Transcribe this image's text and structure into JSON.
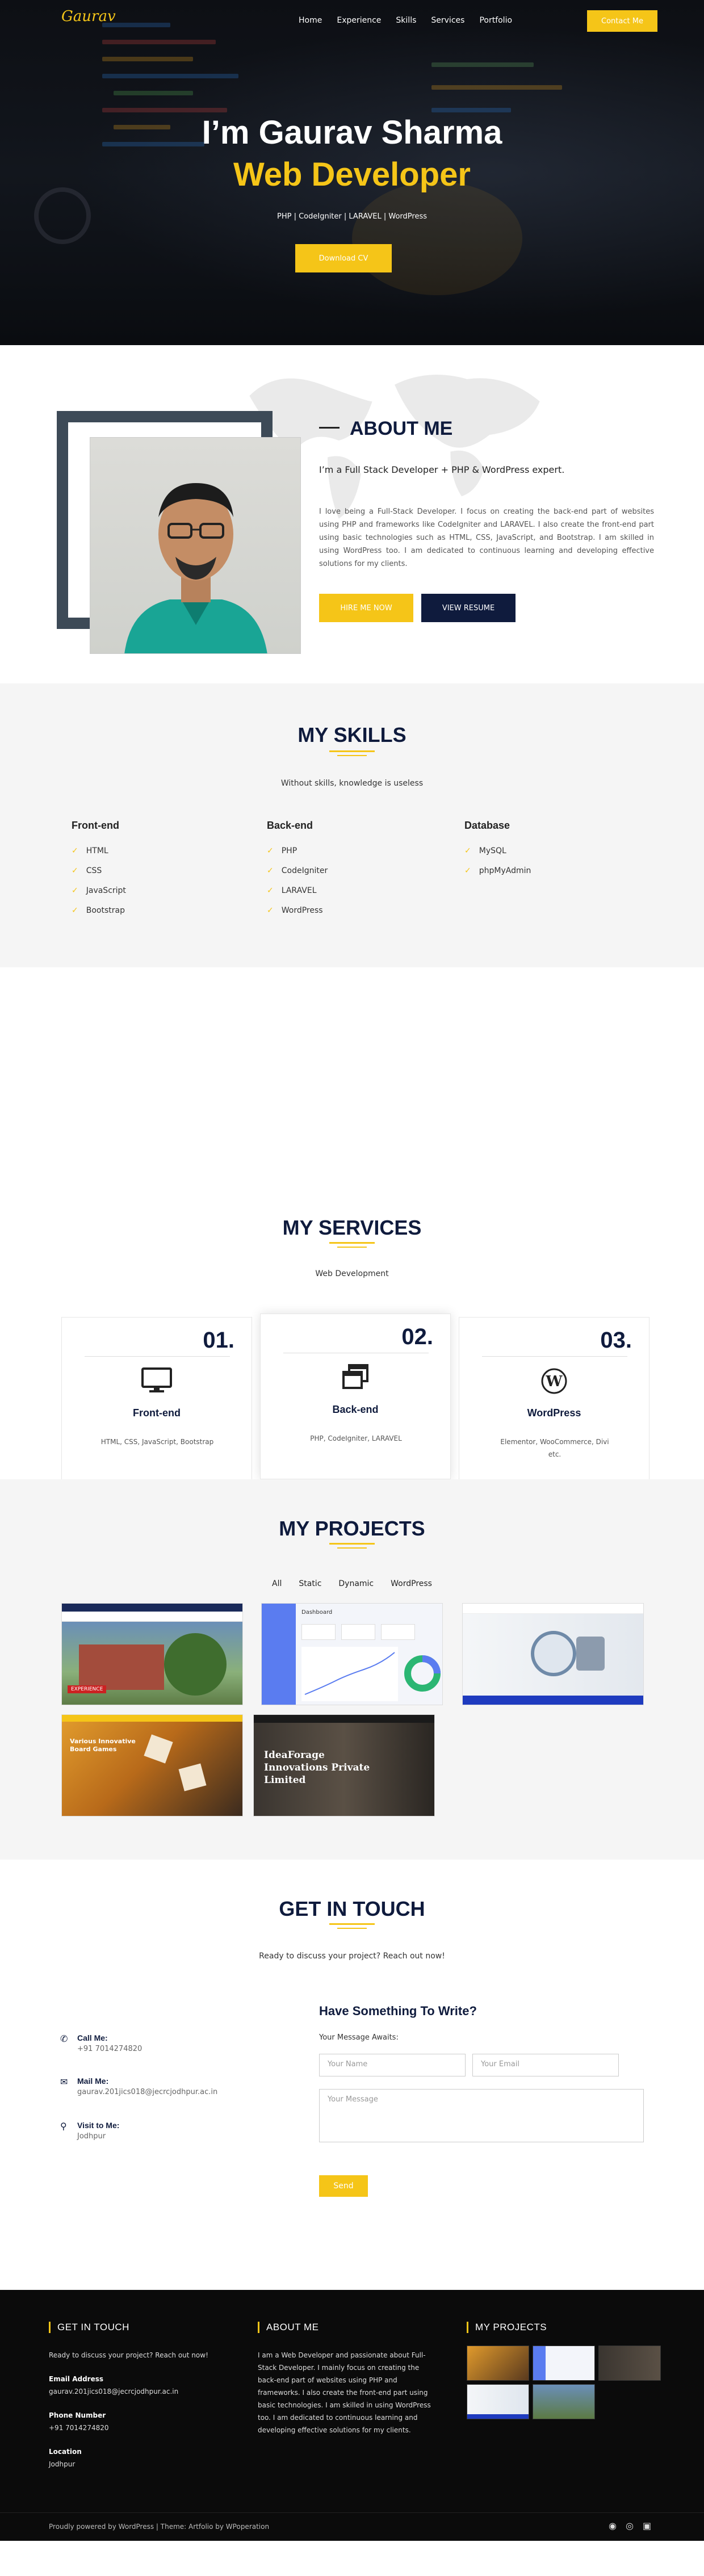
{
  "brand": {
    "logo_text": "Gaurav",
    "accent": "#f5c518",
    "navy": "#0f1b3d"
  },
  "nav": {
    "items": [
      "Home",
      "Experience",
      "Skills",
      "Services",
      "Portfolio"
    ],
    "cta": "Contact Me"
  },
  "hero": {
    "title": "I’m Gaurav Sharma",
    "subtitle": "Web Developer",
    "tags": "PHP | CodeIgniter | LARAVEL | WordPress",
    "button": "Download CV"
  },
  "about": {
    "title": "ABOUT ME",
    "lead": "I’m a Full Stack Developer + PHP & WordPress expert.",
    "text": "I love being a Full-Stack Developer. I focus on creating the back-end part of websites using PHP and frameworks like CodeIgniter and LARAVEL. I also create the front-end part using basic technologies such as HTML, CSS, JavaScript, and Bootstrap. I am skilled in using WordPress too. I am dedicated to continuous learning and developing effective solutions for my clients.",
    "hire_button": "HIRE ME NOW",
    "resume_button": "VIEW RESUME"
  },
  "skills": {
    "title": "MY SKILLS",
    "subtitle": "Without skills, knowledge is useless",
    "columns": [
      {
        "heading": "Front-end",
        "items": [
          "HTML",
          "CSS",
          "JavaScript",
          "Bootstrap"
        ]
      },
      {
        "heading": "Back-end",
        "items": [
          "PHP",
          "CodeIgniter",
          "LARAVEL",
          "WordPress"
        ]
      },
      {
        "heading": "Database",
        "items": [
          "MySQL",
          "phpMyAdmin"
        ]
      }
    ]
  },
  "services": {
    "title": "MY SERVICES",
    "subtitle": "Web Development",
    "cards": [
      {
        "num": "01.",
        "icon": "desktop-icon",
        "name": "Front-end",
        "desc": "HTML, CSS, JavaScript, Bootstrap"
      },
      {
        "num": "02.",
        "icon": "windows-icon",
        "name": "Back-end",
        "desc": "PHP, CodeIgniter, LARAVEL"
      },
      {
        "num": "03.",
        "icon": "wordpress-icon",
        "name": "WordPress",
        "desc": "Elementor, WooCommerce, Divi etc."
      }
    ]
  },
  "projects": {
    "title": "MY PROJECTS",
    "filters": [
      "All",
      "Static",
      "Dynamic",
      "WordPress"
    ],
    "thumbs": [
      {
        "caption": "EXPERIENCE"
      },
      {
        "caption": "Dashboard"
      },
      {
        "caption": ""
      },
      {
        "caption": "Various Innovative Board Games"
      },
      {
        "caption": "IdeaForage Innovations Private Limited"
      }
    ]
  },
  "contact": {
    "title": "GET IN TOUCH",
    "subtitle": "Ready to discuss your project? Reach out now!",
    "info": [
      {
        "label": "Call Me:",
        "value": "+91 7014274820",
        "icon": "phone-icon"
      },
      {
        "label": "Mail Me:",
        "value": "gaurav.201jics018@jecrcjodhpur.ac.in",
        "icon": "mail-icon"
      },
      {
        "label": "Visit to Me:",
        "value": "Jodhpur",
        "icon": "location-icon"
      }
    ],
    "form_title": "Have Something To Write?",
    "form_label": "Your Message Awaits:",
    "name_placeholder": "Your Name",
    "email_placeholder": "Your Email",
    "message_placeholder": "Your Message",
    "send": "Send"
  },
  "footer": {
    "col1_title": "GET IN TOUCH",
    "col1_text": "Ready to discuss your project? Reach out now!",
    "email_label": "Email Address",
    "email": "gaurav.201jics018@jecrcjodhpur.ac.in",
    "phone_label": "Phone Number",
    "phone": "+91 7014274820",
    "location_label": "Location",
    "location": "Jodhpur",
    "col2_title": "ABOUT ME",
    "col2_text": "I am a Web Developer and passionate about Full-Stack Developer. I mainly focus on creating the back-end part of websites using PHP and frameworks. I also create the front-end part using basic technologies. I am skilled in using WordPress too. I am dedicated to continuous learning and developing effective solutions for my clients.",
    "col3_title": "MY PROJECTS",
    "copyright": "Proudly powered by WordPress | Theme: Artfolio by WPoperation",
    "social": [
      "github-icon",
      "instagram-icon",
      "linkedin-icon"
    ]
  }
}
